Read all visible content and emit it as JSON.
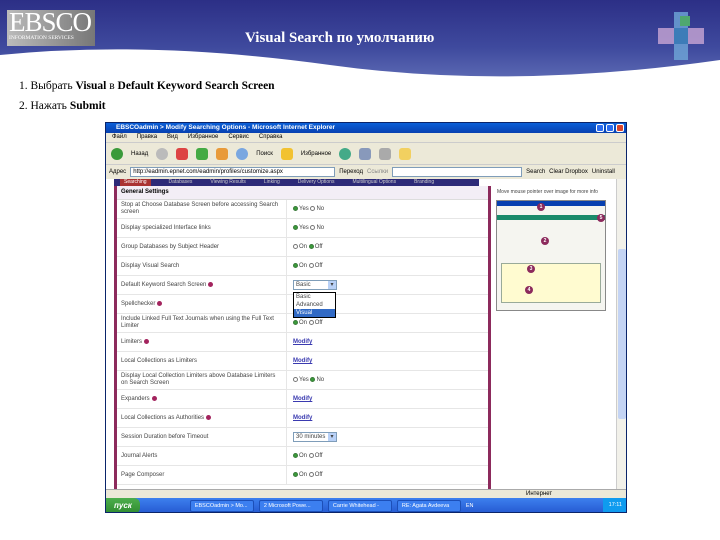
{
  "slide": {
    "title": "Visual Search по умолчанию",
    "logo_text": "EBSCO",
    "logo_subtext": "INFORMATION SERVICES",
    "steps": [
      {
        "num": "1.",
        "pre": "Выбрать ",
        "b1": "Visual",
        "mid": " в ",
        "b2": "Default Keyword Search Screen"
      },
      {
        "num": "2.",
        "pre": "Нажать ",
        "b1": "Submit"
      }
    ]
  },
  "browser": {
    "title": "EBSCOadmin > Modify Searching Options - Microsoft Internet Explorer",
    "menu": [
      "Файл",
      "Правка",
      "Вид",
      "Избранное",
      "Сервис",
      "Справка"
    ],
    "toolbar": {
      "back": "Назад",
      "search": "Поиск",
      "favorites": "Избранное"
    },
    "address_label": "Адрес",
    "url": "http://eadmin.epnet.com/eadmin/profiles/customize.aspx",
    "go": "Переход",
    "links": "Ссылки",
    "search_btn": "Search",
    "clear_btn": "Clear Dropbox",
    "uninstall": "Uninstall",
    "status": "Интернет"
  },
  "tabs": [
    "Searching",
    "Databases",
    "Viewing Results",
    "Linking",
    "Delivery Options",
    "Multilingual Options",
    "Branding"
  ],
  "settings": {
    "heading": "General Settings",
    "rows": [
      {
        "label": "Stop at Choose Database Screen before accessing Search screen",
        "type": "radio",
        "opts": [
          "Yes",
          "No"
        ],
        "sel": 0
      },
      {
        "label": "Display specialized Interface links",
        "type": "radio",
        "opts": [
          "Yes",
          "No"
        ],
        "sel": 0
      },
      {
        "label": "Group Databases by Subject Header",
        "type": "radio",
        "opts": [
          "On",
          "Off"
        ],
        "sel": 1
      },
      {
        "label": "Display Visual Search",
        "type": "radio",
        "opts": [
          "On",
          "Off"
        ],
        "sel": 0
      },
      {
        "label": "Default Keyword Search Screen",
        "type": "select",
        "value": "Basic",
        "help": true,
        "options": [
          "Basic",
          "Advanced",
          "Visual"
        ],
        "highlight": 2
      },
      {
        "label": "Spellchecker",
        "type": "none",
        "help": true
      },
      {
        "label": "Include Linked Full Text Journals when using the Full Text Limiter",
        "type": "radio",
        "opts": [
          "On",
          "Off"
        ],
        "sel": 0
      },
      {
        "label": "Limiters",
        "type": "link",
        "value": "Modify",
        "help": true
      },
      {
        "label": "Local Collections as Limiters",
        "type": "link",
        "value": "Modify"
      },
      {
        "label": "Display Local Collection Limiters above Database Limiters on Search Screen",
        "type": "radio",
        "opts": [
          "Yes",
          "No"
        ],
        "sel": 1
      },
      {
        "label": "Expanders",
        "type": "link",
        "value": "Modify",
        "help": true
      },
      {
        "label": "Local Collections as Authorities",
        "type": "link",
        "value": "Modify",
        "help": true
      },
      {
        "label": "Session Duration before Timeout",
        "type": "selectbox",
        "value": "30 minutes"
      },
      {
        "label": "Journal Alerts",
        "type": "radio",
        "opts": [
          "On",
          "Off"
        ],
        "sel": 0
      },
      {
        "label": "Page Composer",
        "type": "radio",
        "opts": [
          "On",
          "Off"
        ],
        "sel": 0
      }
    ]
  },
  "preview": {
    "caption": "Move mouse pointer over image for more info",
    "markers": [
      "1",
      "2",
      "3",
      "4",
      "5"
    ]
  },
  "taskbar": {
    "start": "пуск",
    "items": [
      "EBSCOadmin > Mo...",
      "2 Microsoft Powe...",
      "Carrie Whitehead -",
      "RE: Agata Avdeeva"
    ],
    "lang": "EN",
    "time": "17:11"
  },
  "colors": {
    "accent": "#8c2a5c",
    "header": "#2c2f86"
  }
}
